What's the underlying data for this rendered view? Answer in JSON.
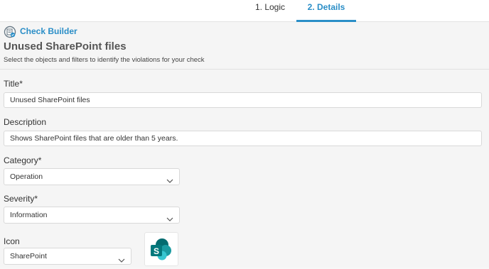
{
  "tabs": [
    {
      "label": "1. Logic"
    },
    {
      "label": "2. Details"
    }
  ],
  "header": {
    "builder_label": "Check Builder",
    "title": "Unused SharePoint files",
    "subtitle": "Select the objects and filters to identify the violations for your check"
  },
  "form": {
    "title_label": "Title*",
    "title_value": "Unused SharePoint files",
    "description_label": "Description",
    "description_value": "Shows SharePoint files that are older than 5 years.",
    "category_label": "Category*",
    "category_value": "Operation",
    "severity_label": "Severity*",
    "severity_value": "Information",
    "icon_label": "Icon",
    "icon_value": "SharePoint"
  },
  "colors": {
    "accent": "#2a8ec7",
    "sharepoint_dark": "#036c70",
    "sharepoint_mid": "#1a9ba1",
    "sharepoint_light": "#37c6d0"
  }
}
